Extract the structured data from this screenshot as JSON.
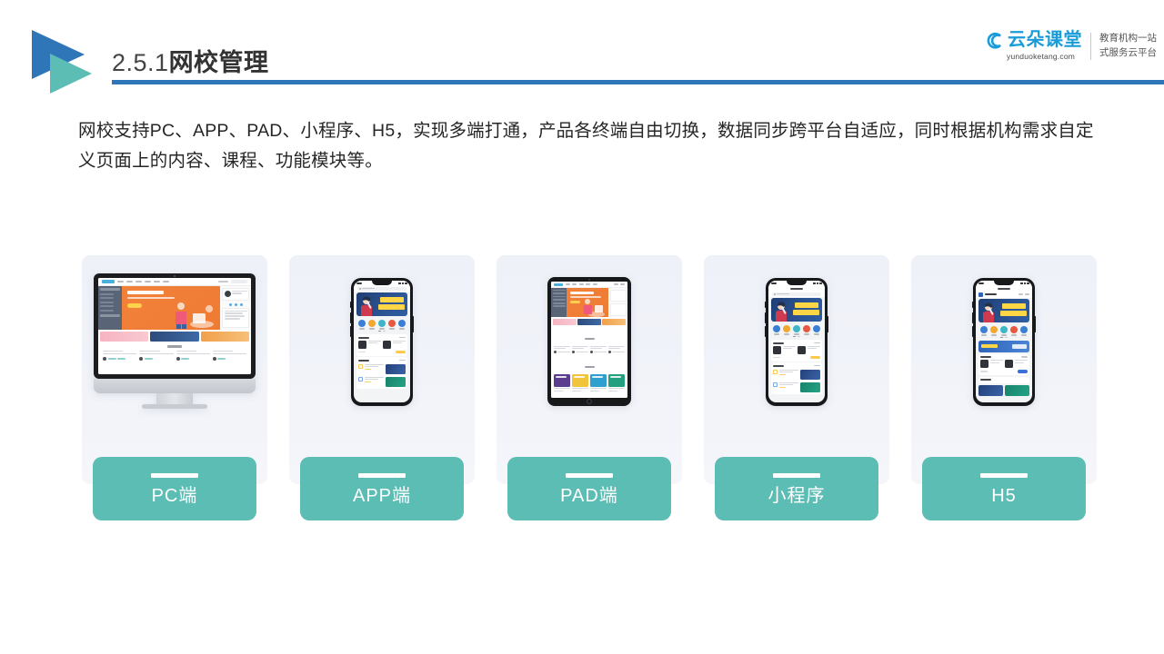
{
  "header": {
    "section_number": "2.5.1",
    "section_title": "网校管理",
    "rule_color": "#2f76b8",
    "logo_triangle_blue": "#2f76b8",
    "logo_triangle_teal": "#5cbdb4"
  },
  "brand": {
    "name_cn": "云朵课堂",
    "url": "yunduoketang.com",
    "tagline_line1": "教育机构一站",
    "tagline_line2": "式服务云平台",
    "color": "#1a9cd8"
  },
  "body": {
    "paragraph": "网校支持PC、APP、PAD、小程序、H5，实现多端打通，产品各终端自由切换，数据同步跨平台自适应，同时根据机构需求自定义页面上的内容、课程、功能模块等。"
  },
  "cards": {
    "pill_color": "#5cbdb4",
    "card_bg_top": "#eef1f8",
    "card_bg_bottom": "#f5f6fa",
    "items": [
      {
        "label": "PC端",
        "device": "desktop",
        "name": "pc"
      },
      {
        "label": "APP端",
        "device": "phone",
        "name": "app"
      },
      {
        "label": "PAD端",
        "device": "tablet",
        "name": "pad"
      },
      {
        "label": "小程序",
        "device": "phone",
        "name": "miniprogram"
      },
      {
        "label": "H5",
        "device": "phone",
        "name": "h5"
      }
    ]
  },
  "mockup": {
    "hero_banner_text": "职场人的第一堂沟通课",
    "site_hero_color": "#f2813a",
    "app_banner_color": "#2b5391",
    "sidebar_color": "#596577"
  }
}
